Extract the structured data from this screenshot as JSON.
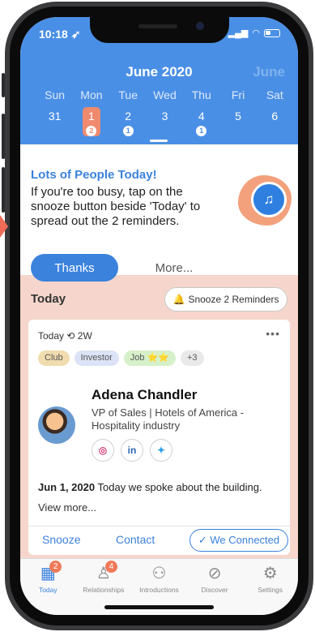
{
  "status": {
    "time": "10:18",
    "time_icon": "location-arrow-icon"
  },
  "calendar": {
    "month": "June 2020",
    "next_month": "June",
    "weekdays": [
      "Sun",
      "Mon",
      "Tue",
      "Wed",
      "Thu",
      "Fri",
      "Sat"
    ],
    "days": [
      {
        "day": "31",
        "badge": ""
      },
      {
        "day": "1",
        "badge": "2"
      },
      {
        "day": "2",
        "badge": "1"
      },
      {
        "day": "3",
        "badge": ""
      },
      {
        "day": "4",
        "badge": "1"
      },
      {
        "day": "5",
        "badge": ""
      },
      {
        "day": "6",
        "badge": ""
      }
    ],
    "selected_index": 1
  },
  "tip": {
    "title": "Lots of People Today!",
    "body": "If you're too busy, tap on the snooze button beside 'Today' to spread out the 2 reminders.",
    "primary_label": "Thanks",
    "secondary_label": "More..."
  },
  "today": {
    "label": "Today",
    "snooze_label": "Snooze 2 Reminders"
  },
  "card": {
    "meta_when": "Today",
    "meta_frequency": "2W",
    "tags": [
      {
        "label": "Club",
        "color": "#f0dcae"
      },
      {
        "label": "Investor",
        "color": "#dde3f6"
      },
      {
        "label": "Job ⭐⭐",
        "color": "#d6f0c9"
      },
      {
        "label": "+3",
        "color": "#e9e9e9"
      }
    ],
    "name": "Adena Chandler",
    "title": "VP of Sales | Hotels of America - Hospitality industry",
    "socials": [
      {
        "icon": "instagram-icon",
        "glyph": "◎",
        "color": "#d63f78"
      },
      {
        "icon": "linkedin-icon",
        "glyph": "in",
        "color": "#2a66b2"
      },
      {
        "icon": "twitter-icon",
        "glyph": "✦",
        "color": "#2fa0e8"
      }
    ],
    "note_date": "Jun 1, 2020",
    "note_text": "Today we spoke about the building.",
    "view_more": "View more...",
    "actions": {
      "snooze": "Snooze",
      "contact": "Contact",
      "connected": "We Connected"
    }
  },
  "tabs": [
    {
      "label": "Today",
      "icon": "calendar-icon",
      "glyph": "▦",
      "count": "2",
      "active": true
    },
    {
      "label": "Relationships",
      "icon": "people-icon",
      "glyph": "♙",
      "count": "4",
      "active": false
    },
    {
      "label": "Introductions",
      "icon": "handshake-icon",
      "glyph": "⚇",
      "count": "",
      "active": false
    },
    {
      "label": "Discover",
      "icon": "compass-icon",
      "glyph": "⊘",
      "count": "",
      "active": false
    },
    {
      "label": "Settings",
      "icon": "gear-icon",
      "glyph": "⚙",
      "count": "",
      "active": false
    }
  ],
  "colors": {
    "accent": "#3b82dd",
    "header": "#4a8fe6",
    "highlight": "#ef8a6e",
    "today_bg": "#f6d6cc"
  }
}
